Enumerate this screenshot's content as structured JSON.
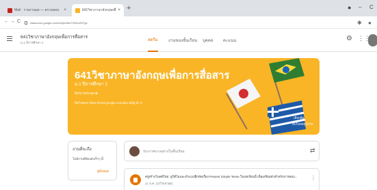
{
  "browser": {
    "tabs": [
      {
        "title": "Mail · รายงานผล — ตรวจสอบ",
        "close": "×"
      },
      {
        "title": "641วิชาภาษาอังกฤษเพื่อการสื่อสาร",
        "close": "×"
      }
    ],
    "new_tab": "+",
    "url": "classroom.google.com/c/MjU4MzY3ODc2NTgz",
    "back": "←",
    "forward": "→",
    "reload": "C",
    "minimize": "–",
    "window_ctrl": "C"
  },
  "header": {
    "class_title": "641วิชาภาษาอังกฤษเพื่อการสื่อสาร",
    "class_sub": "ม.1 ปีการศึกษา 2",
    "tabs": [
      "สตรีม",
      "งานของชั้นเรียน",
      "บุคคล",
      "คะแนน"
    ],
    "icons": [
      "gear-icon",
      "apps-grid-icon"
    ]
  },
  "banner": {
    "title": "641วิชาภาษาอังกฤษเพื่อการสื่อสาร",
    "section": "ม.1 ปีการศึกษา 2",
    "meet_label": "ลิงก์การประชุม ⧉",
    "meet_link": "ลิงก์ Meet: https://meet.google.com/abc-defg-hij  ↻",
    "select_theme": "เลือกธีม",
    "upload_photo": "อัปโหลดรูปภาพ",
    "colors": {
      "bg": "#f9b526"
    }
  },
  "left_card": {
    "title": "งานที่จะถึง",
    "text": "ไม่มีงานที่ต้องส่งเร็วๆ นี้",
    "link": "ดูทั้งหมด"
  },
  "announce": {
    "placeholder": "ประกาศบางอย่างในชั้นเรียน",
    "icon": "repost-icon"
  },
  "stream_item": {
    "text": "ครูสร้างโพสต์ใหม่: ดูวิดีโอและทำแบบฝึกหัดเรื่อง Present Simple Tense ในบทเรียนนี้ เพื่อเตรียมตัวสำหรับการสอบ...",
    "date": "21 ธ.ค. (แก้ไขล่าสุด)",
    "more": "⋮"
  }
}
